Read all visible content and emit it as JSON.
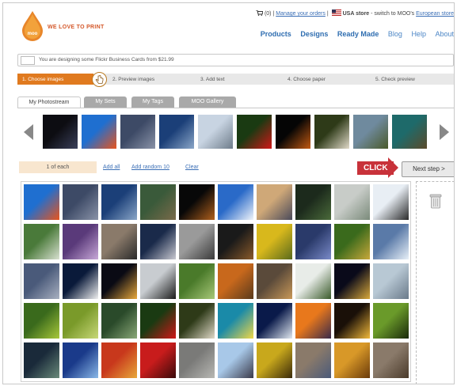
{
  "header": {
    "logo_text": "WE LOVE TO PRINT",
    "cart_text": "(0)",
    "manage_orders": "Manage your orders",
    "store_label": "USA store",
    "switch_text": "- switch to MOO's",
    "european_store": "European store",
    "nav": [
      {
        "label": "Products",
        "style": "strong"
      },
      {
        "label": "Designs",
        "style": "strong"
      },
      {
        "label": "Ready Made",
        "style": "strong"
      },
      {
        "label": "Blog",
        "style": "light"
      },
      {
        "label": "Help",
        "style": "light"
      },
      {
        "label": "About",
        "style": "light"
      }
    ]
  },
  "notice": "You are designing some Flickr Business Cards from $21.99",
  "steps": [
    "1. Choose images",
    "2. Preview images",
    "3. Add text",
    "4. Choose paper",
    "5. Check preview"
  ],
  "active_step": 0,
  "tabs": [
    {
      "label": "My Photostream",
      "active": true
    },
    {
      "label": "My Sets",
      "active": false
    },
    {
      "label": "My Tags",
      "active": false
    },
    {
      "label": "MOO Gallery",
      "active": false
    }
  ],
  "controls": {
    "quantity": "1 of each",
    "add_all": "Add all",
    "add_random": "Add random 10",
    "clear": "Clear",
    "click_label": "CLICK",
    "next_step": "Next step >"
  },
  "colors": {
    "accent": "#e07a1f",
    "link": "#3b6fb6",
    "click_red": "#c8323a"
  },
  "icons": {
    "cart": "cart-icon",
    "flag": "usa-flag-icon",
    "prev": "arrow-left-icon",
    "next": "arrow-right-icon",
    "trash": "trash-icon"
  },
  "carousel_photos": [
    "night-lights",
    "orange-sculpture",
    "city-dusk",
    "mountain-lake",
    "seagull-sign",
    "red-flowers",
    "dark-moon",
    "butterfly",
    "coast-cliffs",
    "green-lagoon"
  ],
  "grid_photos": [
    "orange-sculpture",
    "city-dusk",
    "mountain-lake",
    "tree-stump",
    "night-moon",
    "bird-sky",
    "sunset-city",
    "forest-dark",
    "dollar-bills",
    "bird-silhouette",
    "grass-macro",
    "purple-thistle",
    "dried-plant",
    "space-needle",
    "fountain",
    "night-street",
    "yellow-tulips",
    "blue-flowers",
    "bird-leaves",
    "ocean-waves",
    "harbor-dusk",
    "white-flower-dark",
    "tower-night",
    "penguin",
    "garden-path",
    "autumn-tree",
    "river-dusk",
    "white-blossoms",
    "city-night",
    "pale-water",
    "green-leaves",
    "green-texture",
    "forest-stream",
    "red-flowers",
    "butterfly",
    "snorkeler",
    "clock-window",
    "sunset-sky",
    "candle",
    "green-bird",
    "thistle-dark",
    "blue-lights",
    "fall-leaves",
    "red-sunset",
    "cobblestones",
    "windmill",
    "gold-leaves",
    "canal-boats",
    "autumn-gold",
    "gravel"
  ]
}
